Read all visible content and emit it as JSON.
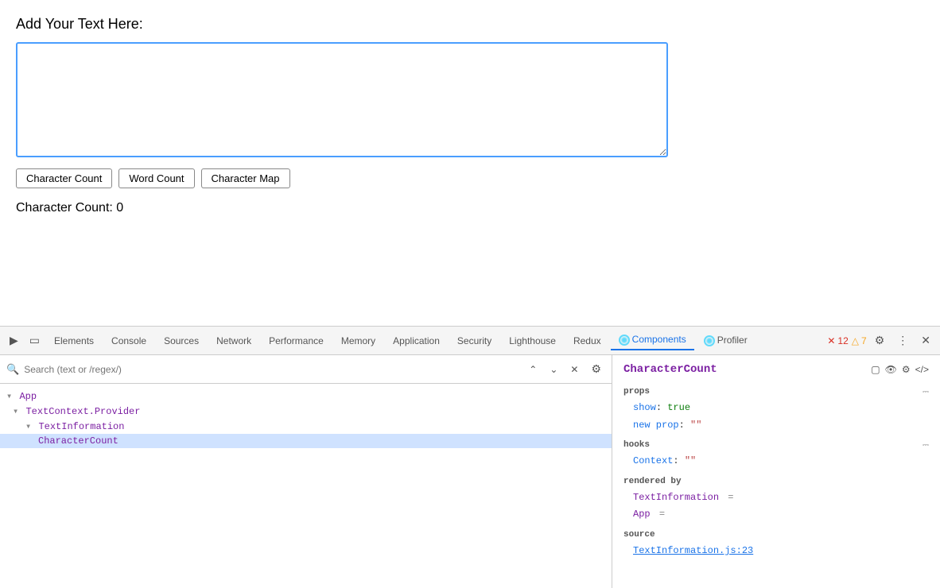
{
  "app": {
    "label": "Add Your Text Here:",
    "textarea_placeholder": "",
    "buttons": [
      {
        "id": "char-count-btn",
        "label": "Character Count"
      },
      {
        "id": "word-count-btn",
        "label": "Word Count"
      },
      {
        "id": "char-map-btn",
        "label": "Character Map"
      }
    ],
    "result": "Character Count: 0"
  },
  "devtools": {
    "tabs": [
      {
        "id": "elements",
        "label": "Elements",
        "active": false
      },
      {
        "id": "console",
        "label": "Console",
        "active": false
      },
      {
        "id": "sources",
        "label": "Sources",
        "active": false
      },
      {
        "id": "network",
        "label": "Network",
        "active": false
      },
      {
        "id": "performance",
        "label": "Performance",
        "active": false
      },
      {
        "id": "memory",
        "label": "Memory",
        "active": false
      },
      {
        "id": "application",
        "label": "Application",
        "active": false
      },
      {
        "id": "security",
        "label": "Security",
        "active": false
      },
      {
        "id": "lighthouse",
        "label": "Lighthouse",
        "active": false
      },
      {
        "id": "redux",
        "label": "Redux",
        "active": false
      },
      {
        "id": "components",
        "label": "Components",
        "active": true
      },
      {
        "id": "profiler",
        "label": "Profiler",
        "active": false
      }
    ],
    "error_count": "12",
    "warn_count": "7",
    "search_placeholder": "Search (text or /regex/)",
    "component_tree": [
      {
        "id": "app",
        "label": "▾ App",
        "indent": 0,
        "type": "component"
      },
      {
        "id": "textcontext-provider",
        "label": "▾ TextContext.Provider",
        "indent": 1,
        "type": "component"
      },
      {
        "id": "textinformation",
        "label": "▾ TextInformation",
        "indent": 2,
        "type": "component"
      },
      {
        "id": "charactercount",
        "label": "CharacterCount",
        "indent": 3,
        "type": "component",
        "selected": true
      }
    ],
    "selected_component": {
      "name": "CharacterCount",
      "props": {
        "show": "true",
        "new_prop": "\"\""
      },
      "hooks": {
        "context": "\"\""
      },
      "rendered_by": [
        "TextInformation",
        "App"
      ],
      "source": "TextInformation.js:23"
    }
  }
}
